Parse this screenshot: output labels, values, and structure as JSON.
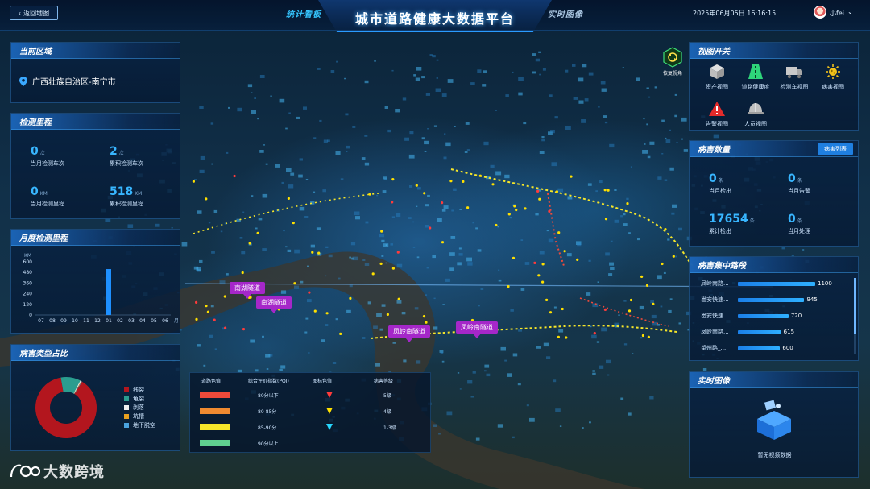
{
  "header": {
    "back_label": "返回地图",
    "title": "城市道路健康大数据平台",
    "tab_stats": "统计看板",
    "tab_live": "实时图像",
    "datetime": "2025年06月05日 16:16:15",
    "username": "小fei"
  },
  "region_panel": {
    "title": "当前区域",
    "region": "广西壮族自治区-南宁市"
  },
  "mileage_panel": {
    "title": "检测里程",
    "stats": [
      {
        "value": "0",
        "unit": "次",
        "label": "当月检测车次"
      },
      {
        "value": "2",
        "unit": "次",
        "label": "累积检测车次"
      },
      {
        "value": "0",
        "unit": "KM",
        "label": "当月检测里程"
      },
      {
        "value": "518",
        "unit": "KM",
        "label": "累积检测里程"
      }
    ]
  },
  "monthly_panel": {
    "title": "月度检测里程"
  },
  "chart_data": [
    {
      "type": "bar",
      "title": "月度检测里程",
      "ylabel": "KM",
      "xlabel": "月",
      "categories": [
        "07",
        "08",
        "09",
        "10",
        "11",
        "12",
        "01",
        "02",
        "03",
        "04",
        "05",
        "06"
      ],
      "values": [
        0,
        0,
        0,
        0,
        0,
        0,
        518,
        0,
        0,
        0,
        0,
        0
      ],
      "yticks": [
        0,
        120,
        240,
        360,
        480,
        600
      ],
      "ylim": [
        0,
        600
      ],
      "color": "#1e90ff"
    },
    {
      "type": "pie",
      "title": "病害类型占比",
      "donut": true,
      "labels": [
        "线裂",
        "龟裂",
        "剥落",
        "坑槽",
        "地下脱空"
      ],
      "values": [
        88.5,
        10.5,
        0.5,
        0.3,
        0.2
      ],
      "colors": [
        "#b3161e",
        "#2a9d8f",
        "#f0f0f0",
        "#e8a020",
        "#4aa3df"
      ]
    }
  ],
  "pie_panel": {
    "title": "病害类型占比"
  },
  "views_panel": {
    "title": "视图开关",
    "items": [
      {
        "label": "资产视图",
        "icon": "cube-icon"
      },
      {
        "label": "道路健康度",
        "icon": "road-icon"
      },
      {
        "label": "检测车视图",
        "icon": "truck-icon"
      },
      {
        "label": "病害视图",
        "icon": "virus-icon"
      },
      {
        "label": "告警视图",
        "icon": "warning-icon"
      },
      {
        "label": "人员视图",
        "icon": "helmet-icon"
      }
    ]
  },
  "restore_view_label": "恢复视角",
  "count_panel": {
    "title": "病害数量",
    "list_button": "病害列表",
    "stats": [
      {
        "value": "0",
        "unit": "条",
        "label": "当月检出"
      },
      {
        "value": "0",
        "unit": "条",
        "label": "当月告警"
      },
      {
        "value": "17654",
        "unit": "条",
        "label": "累计检出"
      },
      {
        "value": "0",
        "unit": "条",
        "label": "当月处理"
      }
    ]
  },
  "roads_panel": {
    "title": "病害集中路段",
    "rows": [
      {
        "name": "凤岭南路...",
        "value": 1100
      },
      {
        "name": "邕安快速...",
        "value": 945
      },
      {
        "name": "邕安快速...",
        "value": 720
      },
      {
        "name": "凤岭南路...",
        "value": 615
      },
      {
        "name": "望州路_...",
        "value": 600
      }
    ],
    "max": 1100
  },
  "live_panel": {
    "title": "实时图像",
    "empty_text": "暂无视频数据"
  },
  "pci_table": {
    "headers": [
      "道路色值",
      "综合评价指数(PQI)",
      "图标色值",
      "病害等级"
    ],
    "rows": [
      {
        "color": "#f04a3a",
        "range": "80分以下",
        "marker": "#ff3b3b",
        "level": "5级"
      },
      {
        "color": "#f08a30",
        "range": "80-85分",
        "marker": "#ffe000",
        "level": "4级"
      },
      {
        "color": "#f5e52a",
        "range": "85-90分",
        "marker": "#27d8ff",
        "level": "1-3级"
      },
      {
        "color": "#5fd08f",
        "range": "90分以上",
        "marker": "",
        "level": ""
      }
    ]
  },
  "tunnels": [
    "南湖隧道",
    "南湖隧道",
    "凤岭南隧道",
    "凤岭南隧道"
  ],
  "watermark": "大数跨境"
}
